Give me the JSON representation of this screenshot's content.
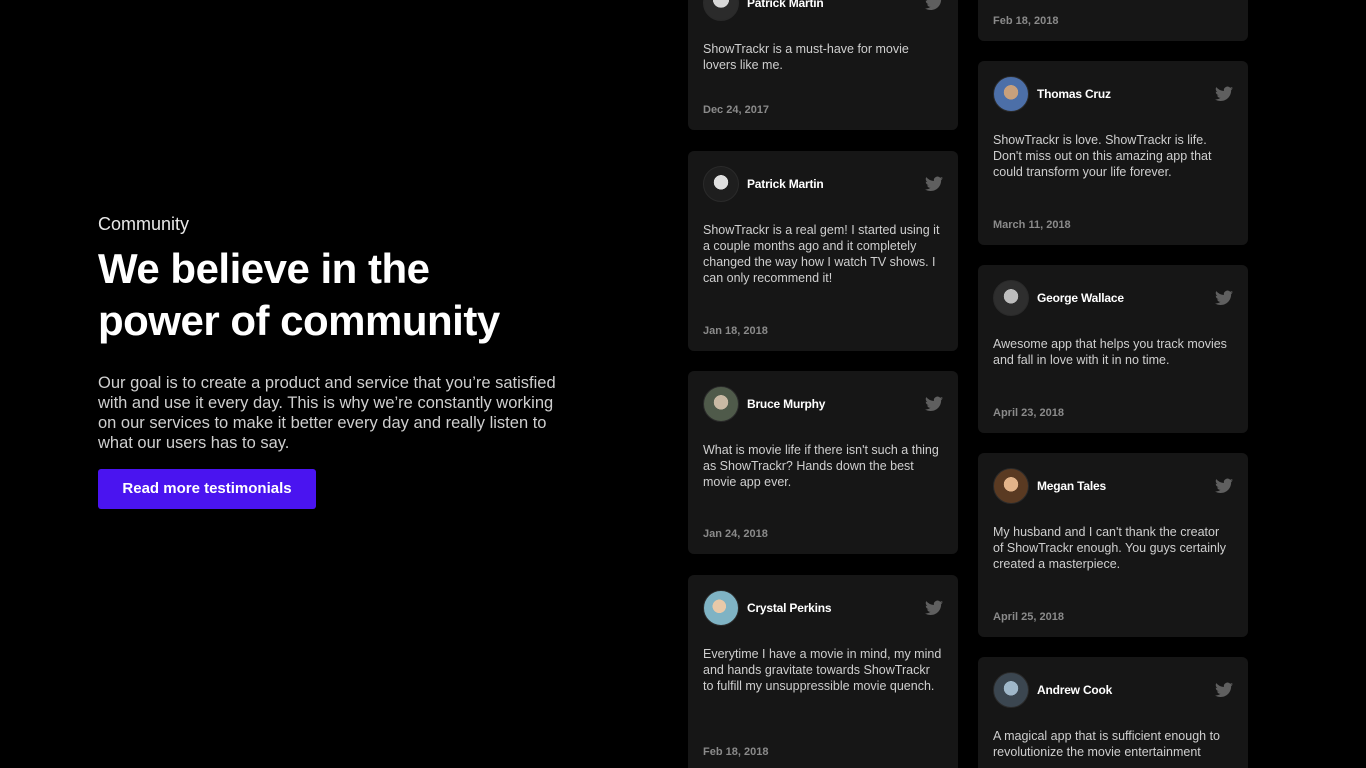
{
  "hero": {
    "eyebrow": "Community",
    "title_line1": "We believe in the",
    "title_line2": "power of community",
    "body": "Our goal is to create a product and service that you’re satisfied with and use it every day. This is why we’re constantly working on our services to make it better every day and really listen to what our users has to say.",
    "cta_label": "Read more testimonials"
  },
  "colors": {
    "background": "#000000",
    "card": "#161616",
    "accent": "#4a14f0",
    "muted": "#8a8a8a"
  },
  "testimonials_left": [
    {
      "name": "Patrick Martin",
      "quote": "ShowTrackr is a must-have for movie lovers like me.",
      "date": "Dec 24, 2017",
      "icon": "twitter-icon"
    },
    {
      "name": "Patrick Martin",
      "quote": "ShowTrackr is a real gem! I started using it a couple months ago and it completely changed the way how I watch TV shows. I can only recommend it!",
      "date": "Jan 18, 2018",
      "icon": "twitter-icon"
    },
    {
      "name": "Bruce Murphy",
      "quote": "What is movie life if there isn't such a thing as ShowTrackr? Hands down the best movie app ever.",
      "date": "Jan 24, 2018",
      "icon": "twitter-icon"
    },
    {
      "name": "Crystal Perkins",
      "quote": "Everytime I have a movie in mind, my mind and hands gravitate towards ShowTrackr to fulfill my unsuppressible movie quench.",
      "date": "Feb 18, 2018",
      "icon": "twitter-icon"
    }
  ],
  "testimonials_right": [
    {
      "name": "",
      "quote": "",
      "date": "Feb 18, 2018",
      "icon": "twitter-icon"
    },
    {
      "name": "Thomas Cruz",
      "quote": "ShowTrackr is love. ShowTrackr is life. Don't miss out on this amazing app that could transform your life forever.",
      "date": "March 11, 2018",
      "icon": "twitter-icon"
    },
    {
      "name": "George Wallace",
      "quote": "Awesome app that helps you track movies and fall in love with it in no time.",
      "date": "April 23, 2018",
      "icon": "twitter-icon"
    },
    {
      "name": "Megan Tales",
      "quote": "My husband and I can't thank the creator of ShowTrackr enough. You guys certainly created a masterpiece.",
      "date": "April 25, 2018",
      "icon": "twitter-icon"
    },
    {
      "name": "Andrew Cook",
      "quote": "A magical app that is sufficient enough to revolutionize the movie entertainment",
      "date": "",
      "icon": "twitter-icon"
    }
  ]
}
